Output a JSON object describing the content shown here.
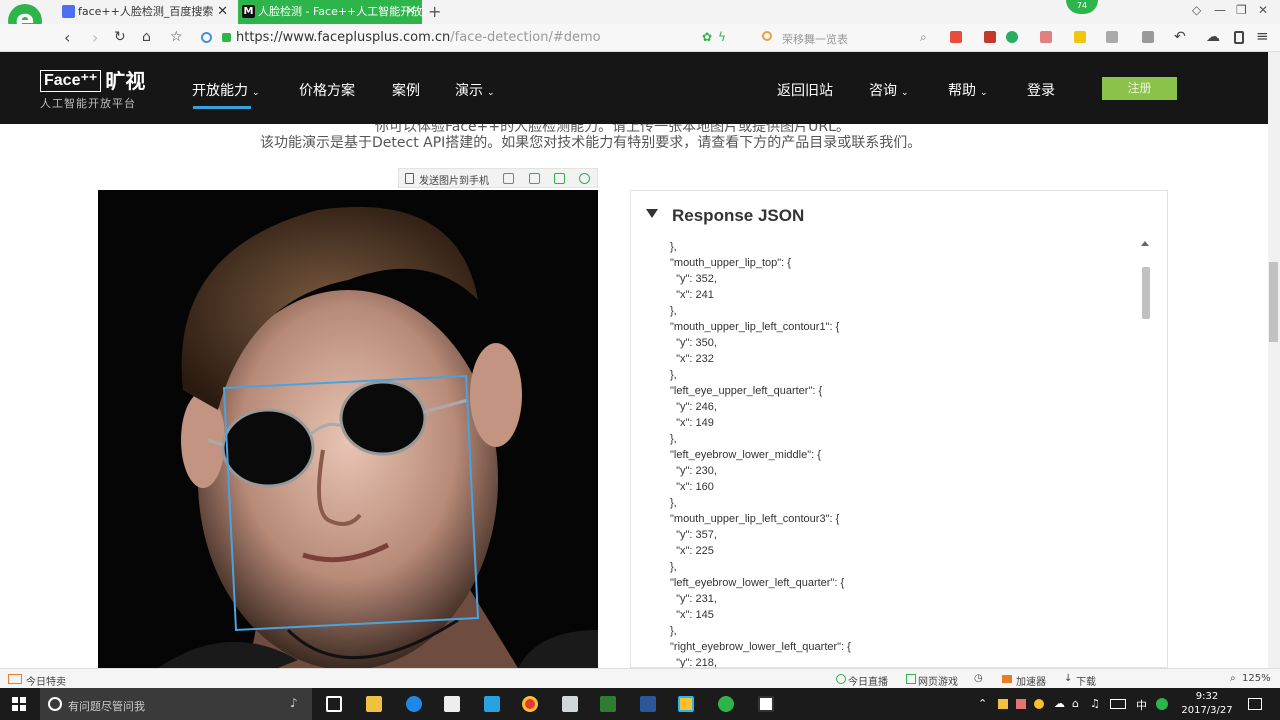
{
  "browser": {
    "tabs": [
      {
        "title": "face++人脸检测_百度搜索",
        "active": false
      },
      {
        "title": "人脸检测 - Face++人工智能开放",
        "active": true
      }
    ],
    "url_main": "https://www.faceplusplus.com.cn",
    "url_path": "/face-detection/#demo",
    "search_hint": "荣移舞一览表",
    "badge": "74"
  },
  "site": {
    "brand_face": "Face⁺⁺",
    "brand_cn": "旷视",
    "brand_sub": "人工智能开放平台",
    "nav_left": [
      "开放能力",
      "价格方案",
      "案例",
      "演示"
    ],
    "nav_right": [
      "返回旧站",
      "咨询",
      "帮助",
      "登录"
    ],
    "register": "注册",
    "accent_color": "#39a0db",
    "register_color": "#8bc34a"
  },
  "content": {
    "intro_line1": "你可以体验Face++的人脸检测能力。请上传一张本地图片或提供图片URL。",
    "intro_line2": "该功能演示是基于Detect API搭建的。如果您对技术能力有特别要求，请查看下方的产品目录或联系我们。",
    "send_to_phone": "发送图片到手机",
    "panel_title": "Response JSON",
    "json_lines": [
      "},",
      "\"mouth_upper_lip_top\": {",
      "  \"y\": 352,",
      "  \"x\": 241",
      "},",
      "\"mouth_upper_lip_left_contour1\": {",
      "  \"y\": 350,",
      "  \"x\": 232",
      "},",
      "\"left_eye_upper_left_quarter\": {",
      "  \"y\": 246,",
      "  \"x\": 149",
      "},",
      "\"left_eyebrow_lower_middle\": {",
      "  \"y\": 230,",
      "  \"x\": 160",
      "},",
      "\"mouth_upper_lip_left_contour3\": {",
      "  \"y\": 357,",
      "  \"x\": 225",
      "},",
      "\"left_eyebrow_lower_left_quarter\": {",
      "  \"y\": 231,",
      "  \"x\": 145",
      "},",
      "\"right_eyebrow_lower_left_quarter\": {",
      "  \"y\": 218,"
    ]
  },
  "statusbar": {
    "left": "今日特卖",
    "items": [
      "今日直播",
      "网页游戏",
      "加速器",
      "下载"
    ],
    "zoom": "125%"
  },
  "taskbar": {
    "search_placeholder": "有问题尽管问我",
    "time": "9:32",
    "date": "2017/3/27",
    "ime": "中"
  }
}
